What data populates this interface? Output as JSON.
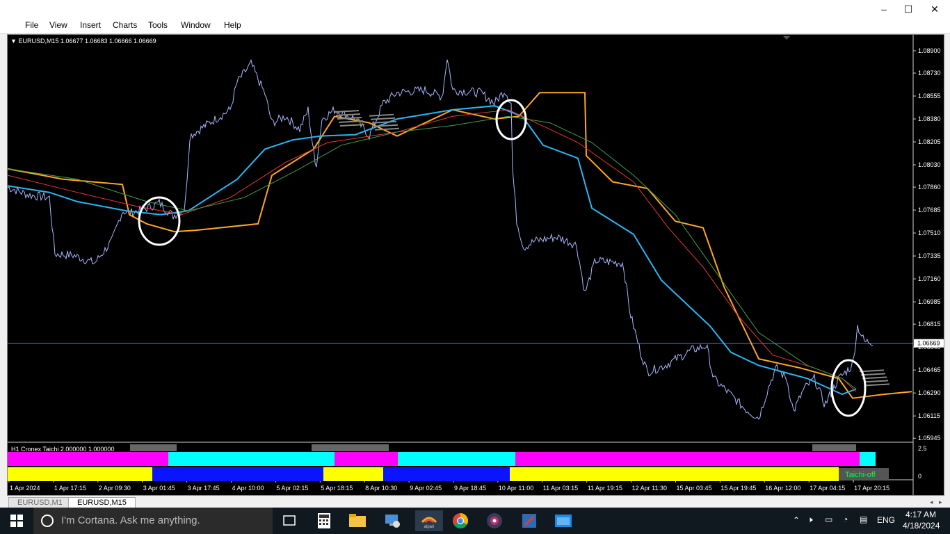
{
  "window": {
    "controls": {
      "minimize": "–",
      "maximize": "☐",
      "close": "✕"
    }
  },
  "menu": [
    "File",
    "View",
    "Insert",
    "Charts",
    "Tools",
    "Window",
    "Help"
  ],
  "chart": {
    "header": "EURUSD,M15  1.06677 1.06683 1.06666 1.06669",
    "current_price": "1.06669",
    "price_axis": [
      "1.08900",
      "1.08730",
      "1.08555",
      "1.08380",
      "1.08205",
      "1.08030",
      "1.07860",
      "1.07685",
      "1.07510",
      "1.07335",
      "1.07160",
      "1.06985",
      "1.06815",
      "1.06640",
      "1.06465",
      "1.06290",
      "1.06115",
      "1.05945"
    ],
    "time_axis": [
      "1 Apr 2024",
      "1 Apr 17:15",
      "2 Apr 09:30",
      "3 Apr 01:45",
      "3 Apr 17:45",
      "4 Apr 10:00",
      "5 Apr 02:15",
      "5 Apr 18:15",
      "8 Apr 10:30",
      "9 Apr 02:45",
      "9 Apr 18:45",
      "10 Apr 11:00",
      "11 Apr 03:15",
      "11 Apr 19:15",
      "12 Apr 11:30",
      "15 Apr 03:45",
      "15 Apr 19:45",
      "16 Apr 12:00",
      "17 Apr 04:15",
      "17 Apr 20:15"
    ],
    "indicator": {
      "label": "H1 Cronex Taichi 2.000000 1.000000",
      "scale_top": "2.5",
      "scale_bottom": "0",
      "status": "Taichi-off"
    },
    "colors": {
      "background": "#000000",
      "price": "#aab8ff",
      "ma_blue": "#29b6f6",
      "ma_red": "#e53935",
      "ma_green": "#43a047",
      "ma_orange": "#ffa726",
      "magenta": "#ff00ff",
      "cyan": "#00ffff",
      "yellow": "#ffff00",
      "blue": "#0a14ff"
    }
  },
  "tabs": [
    "EURUSD,M1",
    "EURUSD,M15"
  ],
  "taskbar": {
    "search_placeholder": "I'm Cortana. Ask me anything.",
    "language": "ENG",
    "time": "4:17 AM",
    "date": "4/18/2024"
  }
}
